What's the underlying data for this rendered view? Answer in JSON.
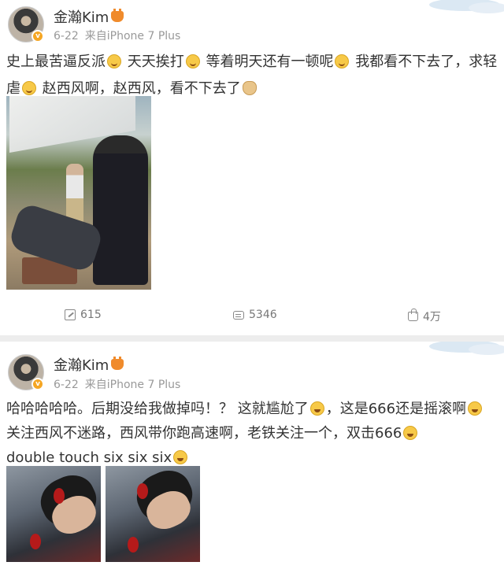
{
  "posts": [
    {
      "username": "金瀚Kim",
      "date": "6-22",
      "source": "来自iPhone 7 Plus",
      "content_segments": [
        {
          "text": "史上最苦逼反派",
          "emoji": "smile"
        },
        {
          "text": " 天天挨打",
          "emoji": "smile"
        },
        {
          "text": " 等着明天还有一顿呢",
          "emoji": "smile"
        },
        {
          "text": " 我都看不下去了，求轻虐",
          "emoji": "smile"
        },
        {
          "text": " 赵西风啊，赵西风，看不下去了",
          "emoji": "doge"
        }
      ],
      "actions": {
        "repost_count": "615",
        "comment_count": "5346",
        "like_count": "4万"
      }
    },
    {
      "username": "金瀚Kim",
      "date": "6-22",
      "source": "来自iPhone 7 Plus",
      "content_segments": [
        {
          "text": "哈哈哈哈哈。后期没给我做掉吗！？ 这就尴尬了",
          "emoji": "laugh"
        },
        {
          "text": "，这是666还是摇滚啊",
          "emoji": "laugh"
        },
        {
          "text": "关注西风不迷路，西风带你跑高速啊，老铁关注一个，双击666",
          "emoji": "laugh"
        },
        {
          "text": " double touch six six six",
          "emoji": "laugh"
        }
      ]
    }
  ],
  "colors": {
    "vip_badge": "#f5a623",
    "text_main": "#333333",
    "text_meta": "#999999",
    "page_bg": "#ededed"
  }
}
